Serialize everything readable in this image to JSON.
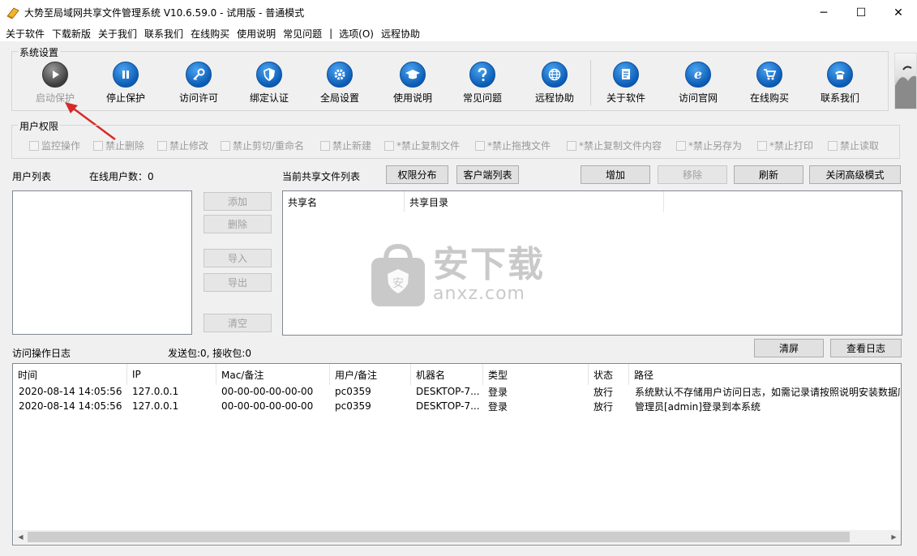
{
  "window": {
    "title": "大势至局域网共享文件管理系统 V10.6.59.0 - 试用版 - 普通模式",
    "minimize_glyph": "─",
    "maximize_glyph": "☐",
    "close_glyph": "✕"
  },
  "menu": [
    "关于软件",
    "下载新版",
    "关于我们",
    "联系我们",
    "在线购买",
    "使用说明",
    "常见问题",
    "|",
    "选项(O)",
    "远程协助"
  ],
  "system_settings": {
    "label": "系统设置",
    "buttons": [
      {
        "label": "启动保护",
        "icon": "play-icon",
        "enabled": false
      },
      {
        "label": "停止保护",
        "icon": "pause-icon",
        "enabled": true
      },
      {
        "label": "访问许可",
        "icon": "key-icon",
        "enabled": true
      },
      {
        "label": "绑定认证",
        "icon": "shield-icon",
        "enabled": true
      },
      {
        "label": "全局设置",
        "icon": "gear-icon",
        "enabled": true
      },
      {
        "label": "使用说明",
        "icon": "graduation-cap-icon",
        "enabled": true
      },
      {
        "label": "常见问题",
        "icon": "question-icon",
        "enabled": true
      },
      {
        "label": "远程协助",
        "icon": "globe-icon",
        "enabled": true
      },
      {
        "label": "关于软件",
        "icon": "document-icon",
        "enabled": true
      },
      {
        "label": "访问官网",
        "icon": "ie-icon",
        "enabled": true
      },
      {
        "label": "在线购买",
        "icon": "cart-icon",
        "enabled": true
      },
      {
        "label": "联系我们",
        "icon": "phone-icon",
        "enabled": true
      }
    ]
  },
  "user_permissions": {
    "label": "用户权限",
    "items": [
      "监控操作",
      "禁止删除",
      "禁止修改",
      "禁止剪切/重命名",
      "禁止新建",
      "*禁止复制文件",
      "*禁止拖拽文件",
      "*禁止复制文件内容",
      "*禁止另存为",
      "*禁止打印",
      "禁止读取"
    ]
  },
  "user_list": {
    "label": "用户列表",
    "online_count_label": "在线用户数：0",
    "buttons": {
      "add": "添加",
      "delete": "删除",
      "import": "导入",
      "export": "导出",
      "clear": "清空"
    }
  },
  "share_list": {
    "label": "当前共享文件列表",
    "perm_dist": "权限分布",
    "client_list": "客户端列表",
    "add": "增加",
    "remove": "移除",
    "refresh": "刷新",
    "close_advanced": "关闭高级模式",
    "columns": [
      "共享名",
      "共享目录"
    ]
  },
  "watermark": {
    "text": "安下载",
    "sub": "anxz.com"
  },
  "log": {
    "label": "访问操作日志",
    "packets": "发送包:0, 接收包:0",
    "clear_screen": "清屏",
    "view_log": "查看日志",
    "columns": [
      "时间",
      "IP",
      "Mac/备注",
      "用户/备注",
      "机器名",
      "类型",
      "状态",
      "路径"
    ],
    "rows": [
      [
        "2020-08-14 14:05:56",
        "127.0.0.1",
        "00-00-00-00-00-00",
        "pc0359",
        "DESKTOP-7...",
        "登录",
        "放行",
        "系统默认不存储用户访问日志，如需记录请按照说明安装数据库"
      ],
      [
        "2020-08-14 14:05:56",
        "127.0.0.1",
        "00-00-00-00-00-00",
        "pc0359",
        "DESKTOP-7...",
        "登录",
        "放行",
        "管理员[admin]登录到本系统"
      ]
    ]
  },
  "colors": {
    "accent_blue": "#0b5cb5",
    "annotation_arrow": "#d42a2a"
  }
}
